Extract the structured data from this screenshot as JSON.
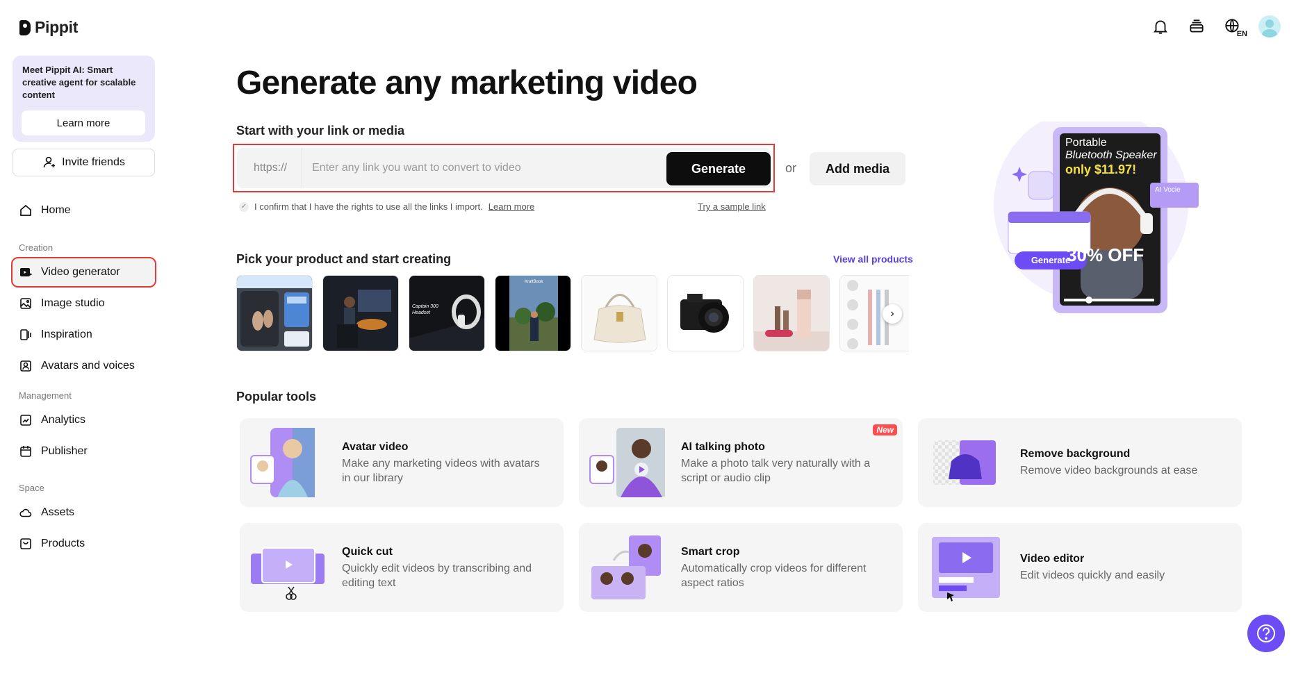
{
  "brand": {
    "name": "Pippit"
  },
  "sidebar": {
    "promo_text": "Meet Pippit AI: Smart creative agent for scalable content",
    "promo_button": "Learn more",
    "invite_label": "Invite friends",
    "home": "Home",
    "section_creation": "Creation",
    "video_generator": "Video generator",
    "image_studio": "Image studio",
    "inspiration": "Inspiration",
    "avatars_voices": "Avatars and voices",
    "section_management": "Management",
    "analytics": "Analytics",
    "publisher": "Publisher",
    "section_space": "Space",
    "assets": "Assets",
    "products": "Products"
  },
  "topbar": {
    "lang": "EN",
    "icons": [
      "bell-icon",
      "stack-icon",
      "globe-icon",
      "user-avatar"
    ]
  },
  "main": {
    "title": "Generate any marketing video",
    "subhead": "Start with your link or media",
    "link_prefix": "https://",
    "link_placeholder": "Enter any link you want to convert to video",
    "generate_label": "Generate",
    "or_label": "or",
    "add_media_label": "Add media",
    "confirm_text": "I confirm that I have the rights to use all the links I import.",
    "confirm_link": "Learn more",
    "sample_link": "Try a sample link",
    "pick_head": "Pick your product and start creating",
    "view_all": "View all products",
    "tools_head": "Popular tools"
  },
  "hero": {
    "line1": "Portable",
    "line2": "Bluetooth Speaker",
    "price": "only $11.97!",
    "discount": "30% OFF",
    "chip": "AI Vocie",
    "button": "Generate"
  },
  "tools": [
    {
      "name": "Avatar video",
      "desc": "Make any marketing videos with avatars in our library"
    },
    {
      "name": "AI talking photo",
      "desc": "Make a photo talk very naturally with a script or audio clip",
      "badge": "New"
    },
    {
      "name": "Remove background",
      "desc": "Remove video backgrounds at ease"
    },
    {
      "name": "Quick cut",
      "desc": "Quickly edit videos by transcribing and editing text"
    },
    {
      "name": "Smart crop",
      "desc": "Automatically crop videos for different aspect ratios"
    },
    {
      "name": "Video editor",
      "desc": "Edit videos quickly and easily"
    }
  ],
  "colors": {
    "accent": "#6e4cf5",
    "highlight": "#e53935",
    "link": "#5b3fd6"
  }
}
